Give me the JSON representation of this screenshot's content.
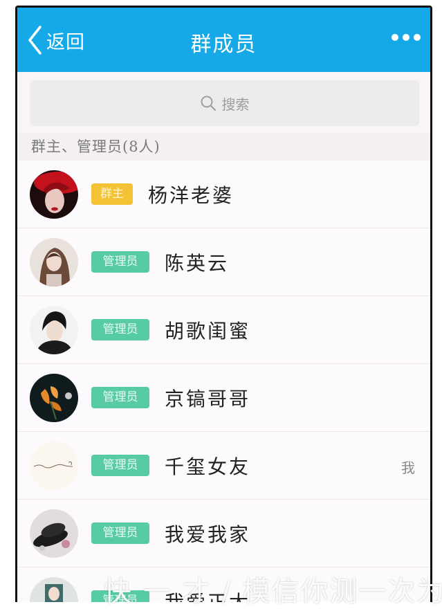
{
  "navbar": {
    "back_label": "返回",
    "title": "群成员",
    "more_icon": "more-dots-icon",
    "color": "#16a9e8"
  },
  "search": {
    "placeholder": "搜索",
    "icon": "search-icon"
  },
  "section": {
    "header": "群主、管理员(8人)"
  },
  "members": [
    {
      "badge": "群主",
      "role": "owner",
      "name": "杨洋老婆",
      "me": ""
    },
    {
      "badge": "管理员",
      "role": "admin",
      "name": "陈英云",
      "me": ""
    },
    {
      "badge": "管理员",
      "role": "admin",
      "name": "胡歌闺蜜",
      "me": ""
    },
    {
      "badge": "管理员",
      "role": "admin",
      "name": "京镐哥哥",
      "me": ""
    },
    {
      "badge": "管理员",
      "role": "admin",
      "name": "千玺女友",
      "me": "我"
    },
    {
      "badge": "管理员",
      "role": "admin",
      "name": "我爱我家",
      "me": ""
    },
    {
      "badge": "管理员",
      "role": "admin",
      "name": "我爱正太",
      "me": ""
    }
  ],
  "colors": {
    "owner_badge": "#f3c235",
    "admin_badge": "#56cba5"
  },
  "watermark": "快 一 才 / 模信你测一次为"
}
